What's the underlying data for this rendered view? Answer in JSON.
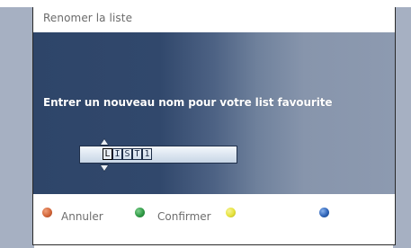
{
  "dialog": {
    "title": "Renomer la liste",
    "prompt": "Entrer un nouveau nom pour votre list favourite"
  },
  "name_field": {
    "characters": [
      "L",
      "I",
      "S",
      "T",
      "1"
    ],
    "active_index": 0
  },
  "footer": {
    "keys": [
      {
        "color_name": "red",
        "color": "#d2663a",
        "label": "Annuler"
      },
      {
        "color_name": "green",
        "color": "#2f9a45",
        "label": "Confirmer"
      },
      {
        "color_name": "yellow",
        "color": "#e6e23a",
        "label": ""
      },
      {
        "color_name": "blue",
        "color": "#2e64b8",
        "label": ""
      }
    ]
  },
  "colors": {
    "content_dark": "#2e4569",
    "content_light": "#8d9ab0",
    "backdrop": "#a6b0c2"
  }
}
